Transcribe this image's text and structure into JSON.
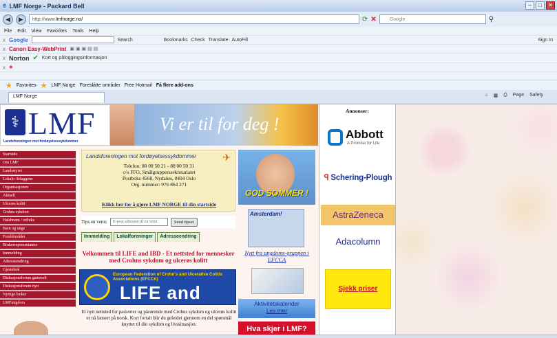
{
  "window": {
    "title": "LMF Norge - Packard Bell"
  },
  "address": {
    "url_prefix": "http://www.",
    "url_host": "lmfnorge.no/",
    "search_placeholder": "Google"
  },
  "menu": [
    "File",
    "Edit",
    "View",
    "Favorites",
    "Tools",
    "Help"
  ],
  "toolbars": {
    "google": {
      "label": "Google",
      "items": [
        "Search",
        "Bookmarks",
        "Check",
        "Translate",
        "AutoFill"
      ],
      "sign_in": "Sign In"
    },
    "canon": {
      "label": "Canon Easy-WebPrint"
    },
    "norton": {
      "label": "Norton",
      "login": "Kort og påloggingsinformasjon"
    }
  },
  "favorites": {
    "label": "Favorites",
    "items": [
      "LMF Norge",
      "Foreslåtte områder",
      "Free Hotmail",
      "Få flere add-ons"
    ]
  },
  "tab": {
    "label": "LMF Norge",
    "tools": [
      "Page",
      "Safety"
    ]
  },
  "site": {
    "logo_text": "LMF",
    "logo_sub": "Landsforeningen mot fordøyelsessykdommer",
    "slogan": "Vi er til for deg !",
    "nav": [
      "Startside",
      "Om LMF",
      "Landsstyret",
      "Lokale-/felaggene",
      "Organisasjonen",
      "Aktuelt",
      "Ulcerøs kolitt",
      "Crohns sykdom",
      "Halsbrann / refluks",
      "Barn og unge",
      "Foreldrerådet",
      "Brukerrepresentanter",
      "Innmelding",
      "Adresseendring",
      "Gjestebok",
      "Diskusjonsforum gammelt",
      "Diskusjonsforum nytt",
      "Nyttige lenker",
      "LMFungdom"
    ],
    "info": {
      "heading": "Landsforeningen mot fordøyelsessykdommer",
      "phone": "Telefon: 88 00 50 21 - 88 00 50 31",
      "line2": "c/o FFO, Smålgrupperssekretariatet",
      "line3": "Postboks 4568, Nydalen, 0404 Oslo",
      "org": "Org. nummer: 976 864 271",
      "link": "Klikk her for å gjøre LMF NORGE til din startside"
    },
    "tips": {
      "label": "Tips en venn:",
      "placeholder": "E-post adressen til en venn",
      "button": "Send tipset"
    },
    "tabs": [
      "Innmelding",
      "Lokalforeninger",
      "Adresseendring"
    ],
    "welcome": "Velkommen til LIFE and IBD - Et nettsted for mennesker med Crohns sykdom og ulcerøs kolitt",
    "efcca": {
      "title": "European Federation of Crohn's and Ulcerative Colitis Associations (EFCCA)",
      "life": "LIFE and IBD"
    },
    "intro": "Et nytt nettsted for pasienter og pårørende med Crohns sykdom og ulcerøs kolitt er nå lansert på norsk. Kort fortalt blir du geleidet gjennom en del spørsmål knyttet til din sykdom og livssituasjon.",
    "sommer": "GOD SOMMER !",
    "amsterdam": "Amsterdam!",
    "nytt": "Nytt fra ungdoms-gruppen i EFCCA",
    "aktivitet": {
      "title": "Aktivitetskalender",
      "more": "Les mer"
    },
    "hva": "Hva skjer i LMF?",
    "ads": {
      "heading": "Annonser:",
      "abbott": "Abbott",
      "abbott_tag": "A Promise for Life",
      "schering_a": "Schering-",
      "schering_b": "Plough",
      "astra": "AstraZeneca",
      "ada": "Adacolumn",
      "sjekk": "Sjekk priser"
    }
  }
}
